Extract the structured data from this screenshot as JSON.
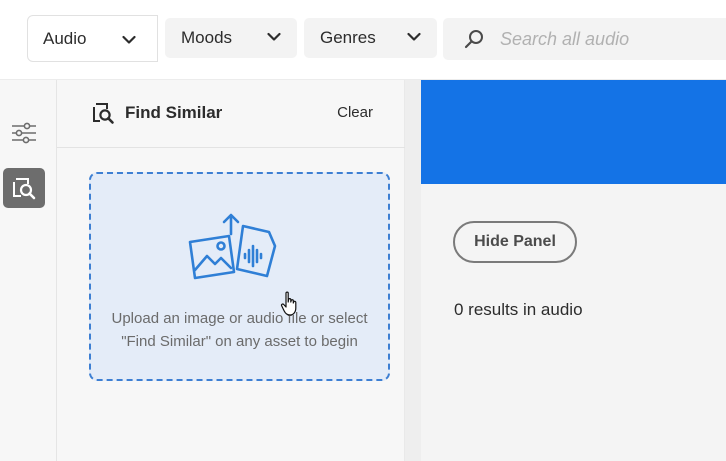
{
  "topbar": {
    "type_select": {
      "value": "Audio",
      "icon": "chevron-down-icon"
    },
    "filters": [
      {
        "label": "Moods",
        "icon": "chevron-down-icon"
      },
      {
        "label": "Genres",
        "icon": "chevron-down-icon"
      }
    ],
    "search": {
      "placeholder": "Search all audio",
      "value": "",
      "icon": "search-icon"
    }
  },
  "rail": {
    "items": [
      {
        "name": "filters",
        "icon": "sliders-icon",
        "active": false
      },
      {
        "name": "find-similar",
        "icon": "image-search-icon",
        "active": true
      }
    ]
  },
  "panel": {
    "title": "Find Similar",
    "title_icon": "image-search-icon",
    "clear_label": "Clear",
    "dropzone": {
      "icon": "upload-media-icon",
      "text": "Upload an image or audio file or select \"Find Similar\" on any asset to begin"
    }
  },
  "main": {
    "hide_panel_label": "Hide Panel",
    "results_text": "0 results in audio"
  },
  "colors": {
    "accent": "#1473e6",
    "dropzone_bg": "#e4ecf8",
    "dropzone_border": "#3d7fd3",
    "rail_active": "#6d6d6d"
  }
}
